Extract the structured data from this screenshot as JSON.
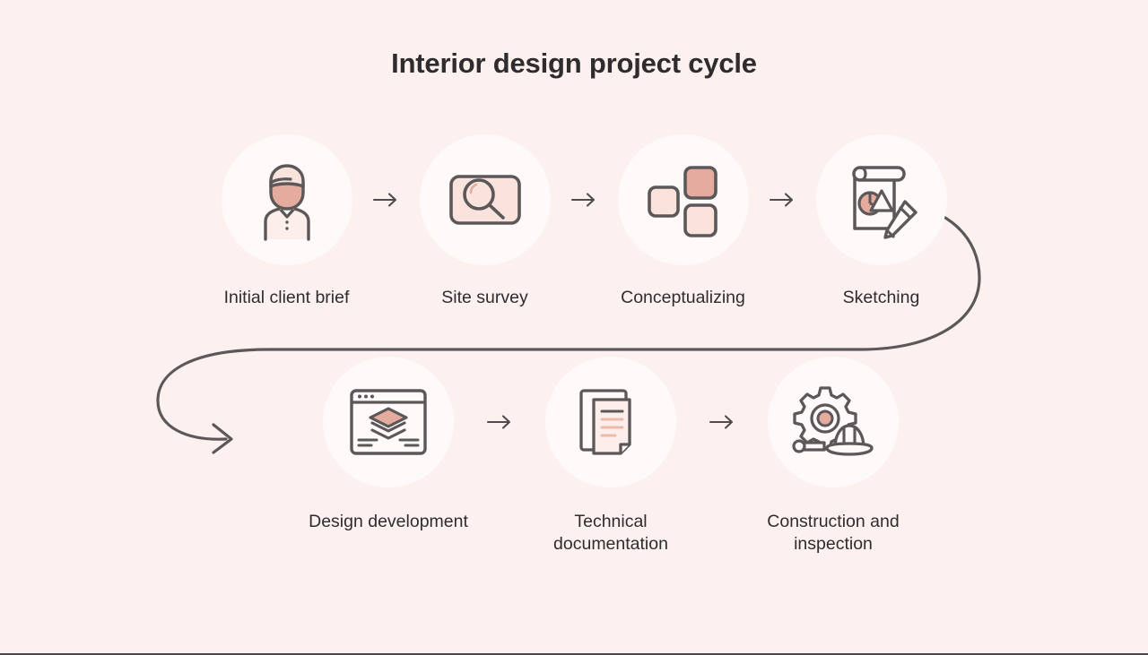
{
  "page": {
    "title": "Interior design project cycle",
    "background_color": "#fdf1ef",
    "circle_color": "#fdfaf9",
    "text_color": "#2e2c2e",
    "stroke_color": "#5c585a",
    "accent_pink": "#e5ab9e",
    "light_pink": "#f7e1dc"
  },
  "flow": {
    "arrow_glyph": "right-arrow",
    "row_top": [
      {
        "label": "Initial client brief",
        "icon": "client-person-icon"
      },
      {
        "label": "Site survey",
        "icon": "magnifier-survey-icon"
      },
      {
        "label": "Conceptualizing",
        "icon": "blocks-concept-icon"
      },
      {
        "label": "Sketching",
        "icon": "sketchpad-pencil-icon"
      }
    ],
    "row_bottom": [
      {
        "label": "Design development",
        "icon": "browser-layers-icon"
      },
      {
        "label": "Technical documentation",
        "icon": "documents-icon"
      },
      {
        "label": "Construction and inspection",
        "icon": "gear-hardhat-icon"
      }
    ],
    "loop_connector": "curved-loop-arrow"
  }
}
